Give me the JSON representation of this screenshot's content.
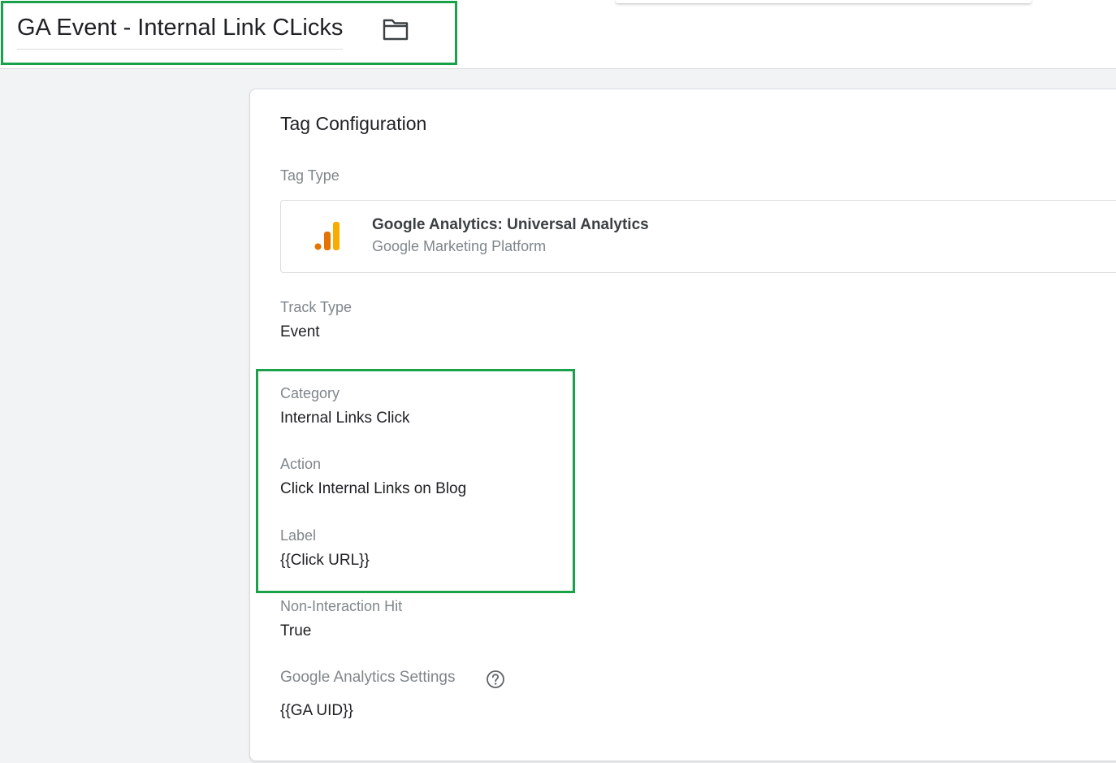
{
  "header": {
    "tag_name": "GA Event - Internal Link CLicks",
    "folder_icon": "folder-icon"
  },
  "card": {
    "title": "Tag Configuration",
    "tag_type": {
      "label": "Tag Type",
      "name": "Google Analytics: Universal Analytics",
      "provider": "Google Marketing Platform",
      "icon": "google-analytics-icon",
      "icon_colors": [
        "#e37400",
        "#f9ab00",
        "#f9ab00"
      ]
    },
    "fields": {
      "track_type": {
        "label": "Track Type",
        "value": "Event"
      },
      "category": {
        "label": "Category",
        "value": "Internal Links Click"
      },
      "action": {
        "label": "Action",
        "value": "Click Internal Links on Blog"
      },
      "event_label": {
        "label": "Label",
        "value": "{{Click URL}}"
      },
      "non_interaction": {
        "label": "Non-Interaction Hit",
        "value": "True"
      },
      "ga_settings": {
        "label": "Google Analytics Settings",
        "value": "{{GA UID}}",
        "icon": "help-icon"
      }
    }
  },
  "colors": {
    "highlight": "#1aa24b",
    "background": "#f1f3f4",
    "label": "#80868b",
    "text": "#202124"
  }
}
